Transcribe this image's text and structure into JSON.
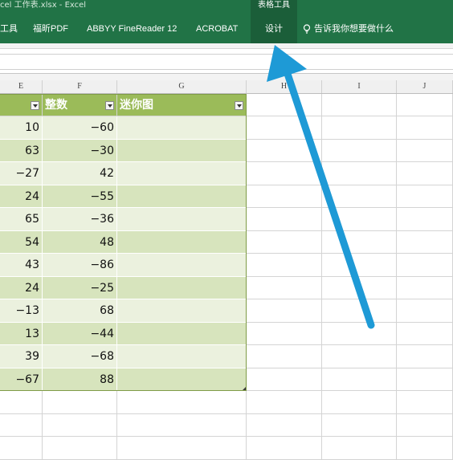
{
  "window": {
    "title": "cel 工作表.xlsx  -  Excel",
    "context_tab_group": "表格工具"
  },
  "ribbon": {
    "tabs": [
      {
        "label": "工具"
      },
      {
        "label": "福昕PDF"
      },
      {
        "label": "ABBYY FineReader 12"
      },
      {
        "label": "ACROBAT"
      },
      {
        "label": "设计",
        "active": true
      }
    ],
    "tell_me": "告诉我你想要做什么"
  },
  "columns": [
    "E",
    "F",
    "G",
    "H",
    "I",
    "J"
  ],
  "table": {
    "headers": [
      "",
      "整数",
      "迷你图"
    ],
    "rows": [
      [
        "10",
        "−60",
        ""
      ],
      [
        "63",
        "−30",
        ""
      ],
      [
        "−27",
        "42",
        ""
      ],
      [
        "24",
        "−55",
        ""
      ],
      [
        "65",
        "−36",
        ""
      ],
      [
        "54",
        "48",
        ""
      ],
      [
        "43",
        "−86",
        ""
      ],
      [
        "24",
        "−25",
        ""
      ],
      [
        "−13",
        "68",
        ""
      ],
      [
        "13",
        "−44",
        ""
      ],
      [
        "39",
        "−68",
        ""
      ],
      [
        "−67",
        "88",
        ""
      ]
    ]
  },
  "colors": {
    "ribbon": "#217346",
    "table_header": "#9bbb59",
    "band_dark": "#d7e4bd",
    "band_light": "#ebf1de",
    "annotation_arrow": "#1e9ad6"
  },
  "annotation": {
    "type": "arrow",
    "points_to": "设计"
  }
}
